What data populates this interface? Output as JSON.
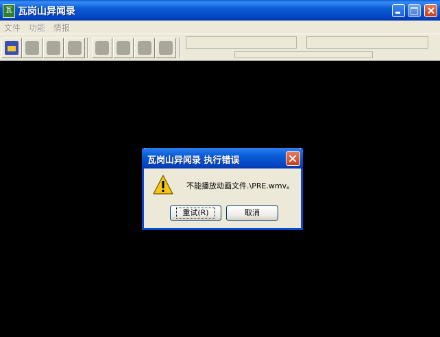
{
  "window": {
    "title": "瓦岗山异闻录",
    "icon_text": "瓦"
  },
  "menubar": {
    "items": [
      "文件",
      "功能",
      "情报"
    ]
  },
  "toolbar": {
    "tools": [
      "castle-icon",
      "mountain-icon",
      "mountain-icon",
      "terrain-icon",
      "map-icon",
      "landscape-icon",
      "peak-icon",
      "book-icon"
    ]
  },
  "dialog": {
    "title": "瓦岗山异闻录  执行错误",
    "message": "不能播放动画文件.\\PRE.wmv。",
    "retry_label": "重试(R)",
    "cancel_label": "取消",
    "icon": "warning-icon"
  },
  "colors": {
    "titlebar": "#0a5fd6",
    "client_bg": "#000000",
    "face": "#ece9d8",
    "close": "#d9532c"
  }
}
